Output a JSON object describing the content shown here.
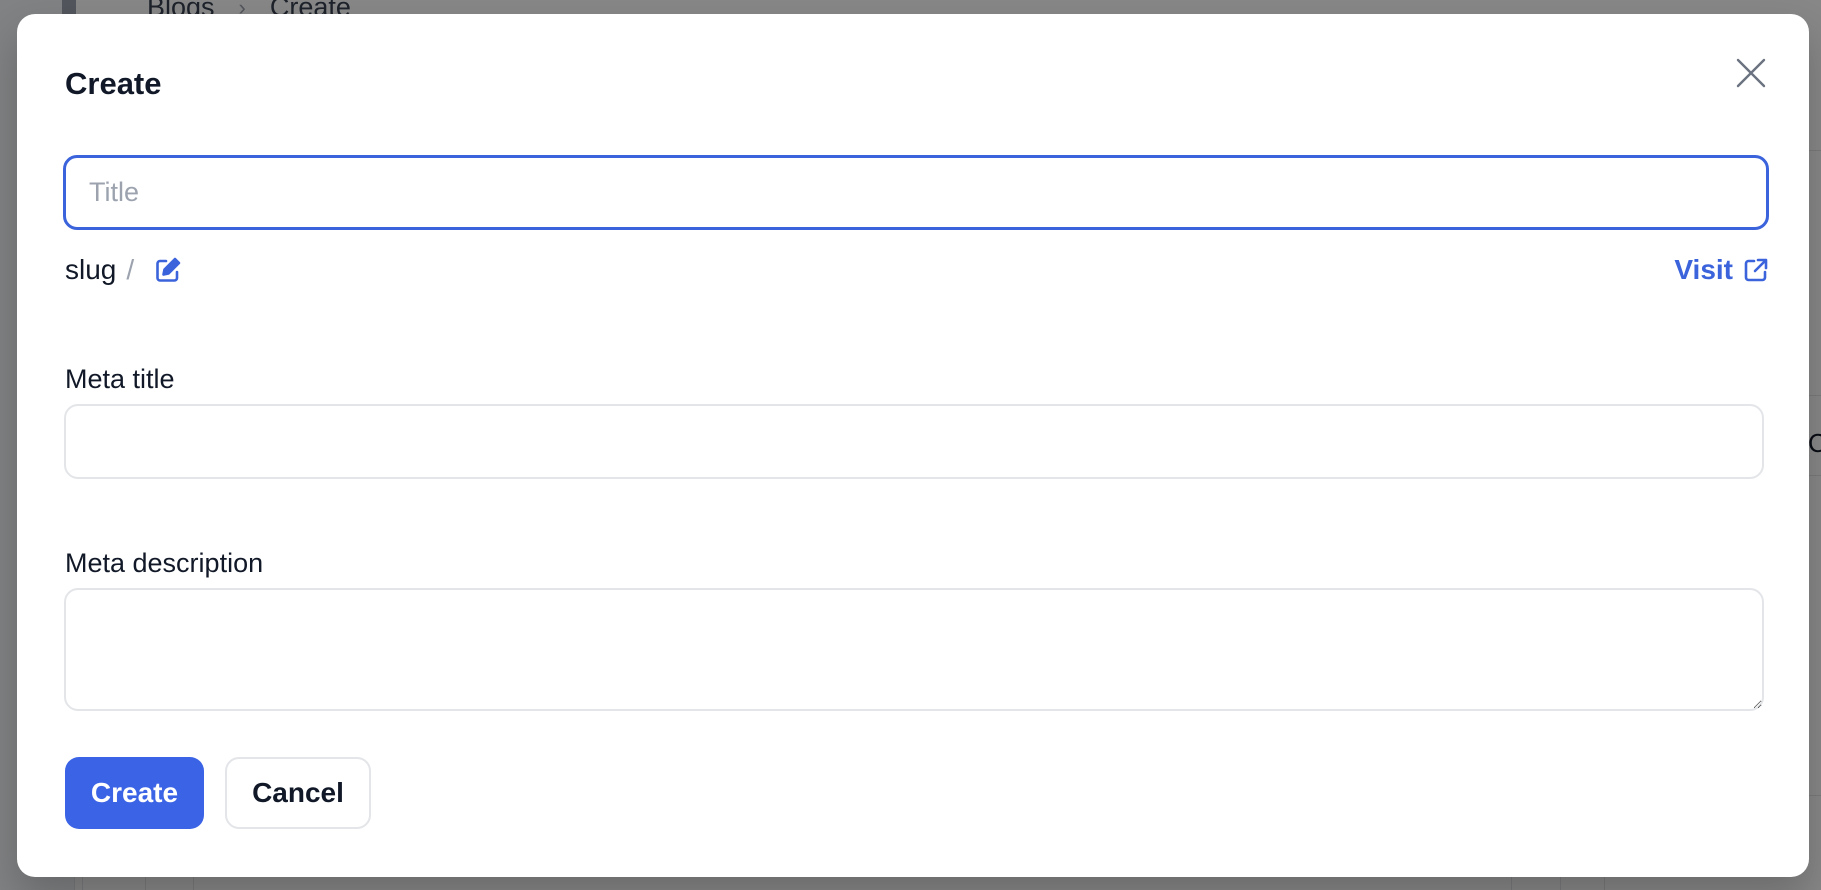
{
  "background": {
    "breadcrumb": [
      "Blogs",
      "Create"
    ],
    "edge_text": "C"
  },
  "modal": {
    "title": "Create",
    "close_icon": "close-icon",
    "title_input": {
      "placeholder": "Title",
      "value": ""
    },
    "slug": {
      "label": "slug",
      "separator": "/",
      "edit_icon": "edit-icon"
    },
    "visit": {
      "label": "Visit",
      "icon": "external-link-icon"
    },
    "meta_title": {
      "label": "Meta title",
      "value": ""
    },
    "meta_description": {
      "label": "Meta description",
      "value": ""
    },
    "buttons": {
      "create": "Create",
      "cancel": "Cancel"
    }
  },
  "colors": {
    "accent": "#3b63e6",
    "focus_border": "#3b63db",
    "overlay": "rgba(0,0,0,0.47)"
  }
}
